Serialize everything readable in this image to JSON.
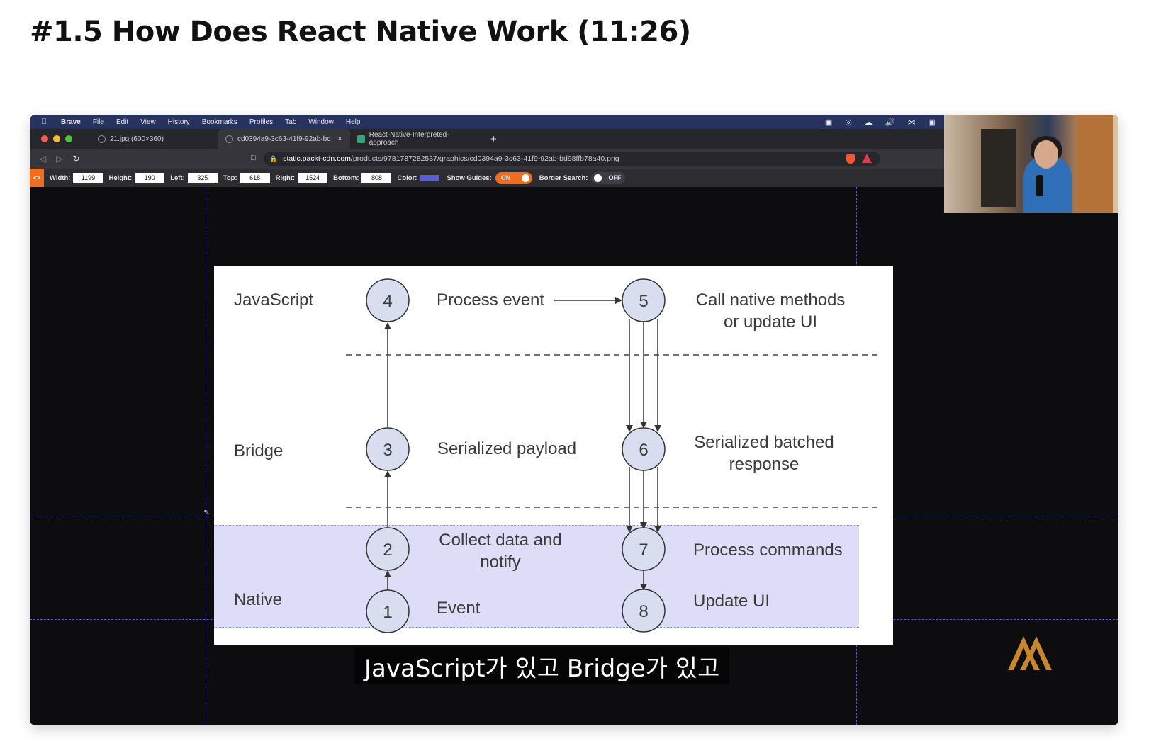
{
  "page": {
    "title": "#1.5 How Does React Native Work (11:26)"
  },
  "menubar": {
    "items": [
      "Brave",
      "File",
      "Edit",
      "View",
      "History",
      "Bookmarks",
      "Profiles",
      "Tab",
      "Window",
      "Help"
    ],
    "apple_icon": "apple-logo"
  },
  "browser": {
    "tabs": [
      {
        "label": "21.jpg (600×360)",
        "active": false
      },
      {
        "label": "cd0394a9-3c63-41f9-92ab-bc",
        "active": true,
        "close": "×"
      },
      {
        "label": "React-Native-Interpreted-approach",
        "active": false
      }
    ],
    "new_tab": "+",
    "url_host": "static.packt-cdn.com",
    "url_path": "/products/9781787282537/graphics/cd0394a9-3c63-41f9-92ab-bd98ffb78a40.png"
  },
  "inspector": {
    "fields": [
      {
        "label": "Width:",
        "value": "1199"
      },
      {
        "label": "Height:",
        "value": "190"
      },
      {
        "label": "Left:",
        "value": "325"
      },
      {
        "label": "Top:",
        "value": "618"
      },
      {
        "label": "Right:",
        "value": "1524"
      },
      {
        "label": "Bottom:",
        "value": "808"
      }
    ],
    "color_label": "Color:",
    "color_value": "#5a5fd0",
    "show_guides_label": "Show Guides:",
    "show_guides_state": "ON",
    "border_search_label": "Border Search:",
    "border_search_state": "OFF"
  },
  "diagram": {
    "lanes": [
      "JavaScript",
      "Bridge",
      "Native"
    ],
    "nodes": [
      "1",
      "2",
      "3",
      "4",
      "5",
      "6",
      "7",
      "8"
    ],
    "steps": {
      "s4": "Process event",
      "s5a": "Call native methods",
      "s5b": "or update UI",
      "s3": "Serialized payload",
      "s6a": "Serialized batched",
      "s6b": "response",
      "s2a": "Collect data and",
      "s2b": "notify",
      "s7": "Process commands",
      "s1": "Event",
      "s8": "Update UI"
    },
    "highlight_color": "#6e6edc"
  },
  "subtitle": "JavaScript가 있고 Bridge가 있고",
  "colors": {
    "menubar": "#27335e",
    "accent_orange": "#ef6d1c",
    "node_fill": "#d8def0",
    "brand_logo": "#c8862e"
  }
}
